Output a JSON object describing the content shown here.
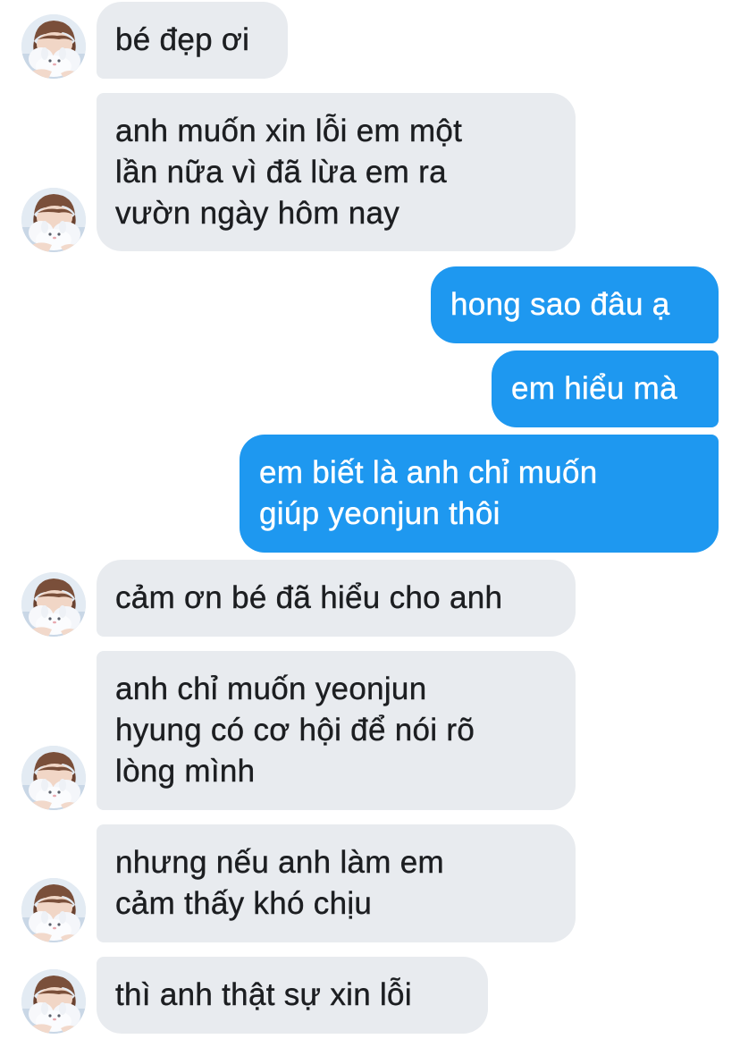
{
  "conversation": {
    "messages": [
      {
        "sender": "other",
        "text": "bé đẹp ơi"
      },
      {
        "sender": "other",
        "text": "anh muốn xin lỗi em một\nlần nữa vì đã lừa em ra\nvườn ngày hôm nay"
      },
      {
        "sender": "self",
        "text": "hong sao đâu ạ"
      },
      {
        "sender": "self",
        "text": "em hiểu mà"
      },
      {
        "sender": "self",
        "text": "em biết là anh chỉ muốn\ngiúp yeonjun thôi"
      },
      {
        "sender": "other",
        "text": "cảm ơn bé đã hiểu cho anh"
      },
      {
        "sender": "other",
        "text": "anh chỉ muốn yeonjun\nhyung có cơ hội để nói rõ\nlòng mình"
      },
      {
        "sender": "other",
        "text": "nhưng nếu anh làm em\ncảm thấy khó chịu"
      },
      {
        "sender": "other",
        "text": "thì anh thật sự xin lỗi"
      }
    ]
  },
  "colors": {
    "incoming_bubble": "#e8ebef",
    "outgoing_bubble": "#1e98f0",
    "incoming_text": "#1c1e21",
    "outgoing_text": "#ffffff"
  },
  "icons": {
    "avatar": "contact-avatar-photo"
  }
}
